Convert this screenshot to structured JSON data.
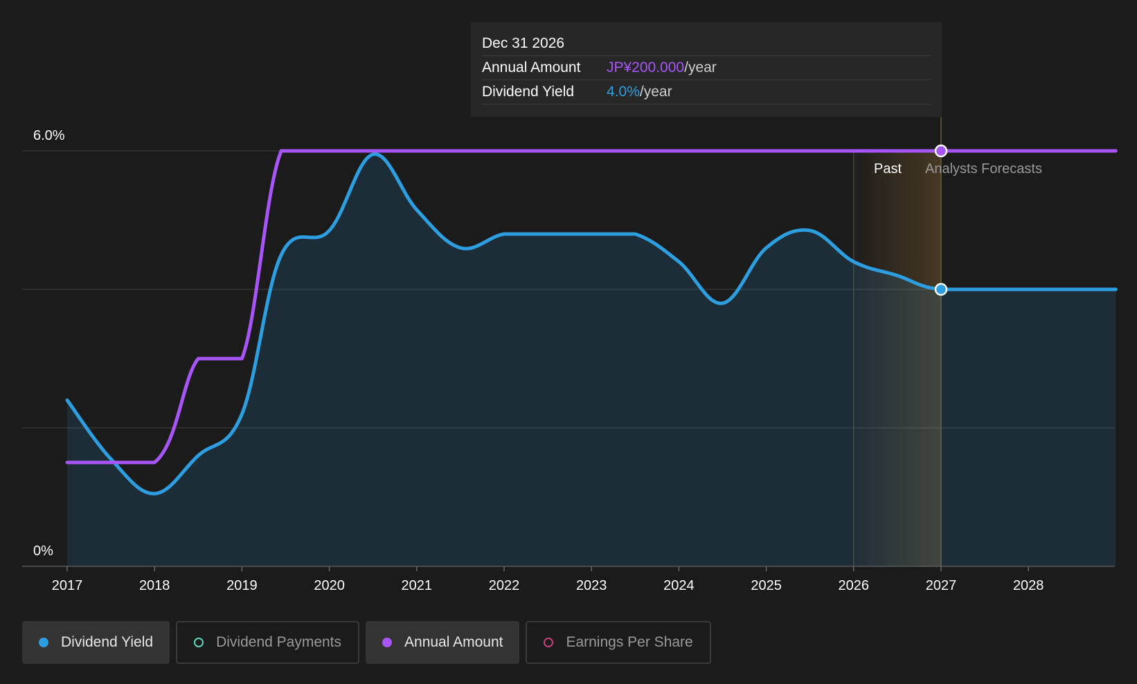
{
  "chart_data": {
    "type": "line",
    "x_ticks": [
      "2017",
      "2018",
      "2019",
      "2020",
      "2021",
      "2022",
      "2023",
      "2024",
      "2025",
      "2026",
      "2027",
      "2028"
    ],
    "y_tick_labels": [
      "6.0%",
      "0%"
    ],
    "ylim": [
      0,
      6.0
    ],
    "xlim": [
      2017,
      2029
    ],
    "grid": true,
    "series": [
      {
        "name": "Dividend Yield",
        "color": "#2d9ee0",
        "area": true,
        "points": [
          [
            2017.0,
            2.4
          ],
          [
            2017.5,
            1.55
          ],
          [
            2018.0,
            1.05
          ],
          [
            2018.5,
            1.6
          ],
          [
            2019.0,
            2.2
          ],
          [
            2019.45,
            4.5
          ],
          [
            2020.0,
            4.85
          ],
          [
            2020.5,
            5.95
          ],
          [
            2021.0,
            5.15
          ],
          [
            2021.5,
            4.6
          ],
          [
            2022.0,
            4.8
          ],
          [
            2022.5,
            4.8
          ],
          [
            2023.0,
            4.8
          ],
          [
            2023.5,
            4.8
          ],
          [
            2024.0,
            4.4
          ],
          [
            2024.5,
            3.8
          ],
          [
            2025.0,
            4.6
          ],
          [
            2025.5,
            4.85
          ],
          [
            2026.0,
            4.4
          ],
          [
            2026.5,
            4.2
          ],
          [
            2027.0,
            4.0
          ],
          [
            2028.0,
            4.0
          ],
          [
            2029.0,
            4.0
          ]
        ]
      },
      {
        "name": "Annual Amount",
        "color": "#a855f7",
        "area": false,
        "points": [
          [
            2017.0,
            1.5
          ],
          [
            2018.0,
            1.5
          ],
          [
            2018.5,
            3.0
          ],
          [
            2019.0,
            3.0
          ],
          [
            2019.45,
            6.0
          ],
          [
            2020.0,
            6.0
          ],
          [
            2021.0,
            6.0
          ],
          [
            2022.0,
            6.0
          ],
          [
            2023.0,
            6.0
          ],
          [
            2024.0,
            6.0
          ],
          [
            2025.0,
            6.0
          ],
          [
            2026.0,
            6.0
          ],
          [
            2027.0,
            6.0
          ],
          [
            2028.0,
            6.0
          ],
          [
            2029.0,
            6.0
          ]
        ]
      }
    ],
    "highlight_region": {
      "from": 2026,
      "to": 2027
    },
    "cursor_x": 2027,
    "region_labels": {
      "past": "Past",
      "forecast": "Analysts Forecasts"
    }
  },
  "tooltip": {
    "date": "Dec 31 2026",
    "rows": [
      {
        "label": "Annual Amount",
        "value": "JP¥200.000",
        "unit": "/year"
      },
      {
        "label": "Dividend Yield",
        "value": "4.0%",
        "unit": "/year"
      }
    ]
  },
  "legend": [
    {
      "label": "Dividend Yield",
      "active": true,
      "color": "#2d9ee0"
    },
    {
      "label": "Dividend Payments",
      "active": false,
      "color": "#5fd6c0"
    },
    {
      "label": "Annual Amount",
      "active": true,
      "color": "#a855f7"
    },
    {
      "label": "Earnings Per Share",
      "active": false,
      "color": "#c2427a"
    }
  ]
}
